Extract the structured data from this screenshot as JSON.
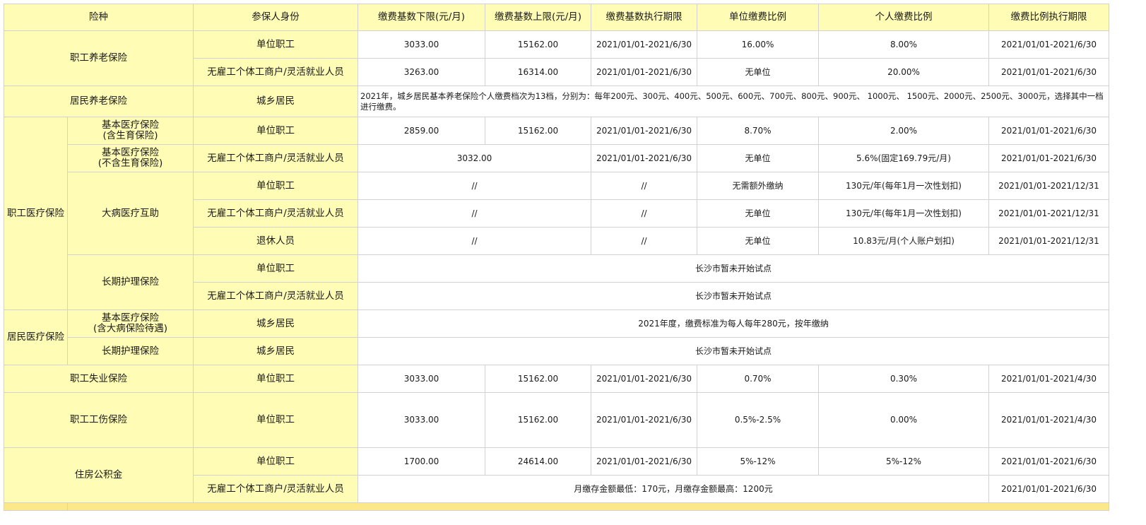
{
  "headers": [
    "险种",
    "参保人身份",
    "缴费基数下限(元/月)",
    "缴费基数上限(元/月)",
    "缴费基数执行期限",
    "单位缴费比例",
    "个人缴费比例",
    "缴费比例执行期限"
  ],
  "pension": {
    "name": "职工养老保险",
    "rows": [
      {
        "identity": "单位职工",
        "lower": "3033.00",
        "upper": "15162.00",
        "base_period": "2021/01/01-2021/6/30",
        "unit_ratio": "16.00%",
        "personal_ratio": "8.00%",
        "ratio_period": "2021/01/01-2021/6/30"
      },
      {
        "identity": "无雇工个体工商户/灵活就业人员",
        "lower": "3263.00",
        "upper": "16314.00",
        "base_period": "2021/01/01-2021/6/30",
        "unit_ratio": "无单位",
        "personal_ratio": "20.00%",
        "ratio_period": "2021/01/01-2021/6/30"
      }
    ]
  },
  "resident_pension": {
    "name": "居民养老保险",
    "identity": "城乡居民",
    "note": "2021年，城乡居民基本养老保险个人缴费档次为13档，分别为：每年200元、300元、400元、500元、600元、700元、800元、900元、 1000元、 1500元、2000元、2500元、3000元，选择其中一档进行缴费。"
  },
  "medical": {
    "name": "职工医疗保险",
    "basic_with_maternity": {
      "sub_line1": "基本医疗保险",
      "sub_line2": "(含生育保险)",
      "identity": "单位职工",
      "lower": "2859.00",
      "upper": "15162.00",
      "base_period": "2021/01/01-2021/6/30",
      "unit_ratio": "8.70%",
      "personal_ratio": "2.00%",
      "ratio_period": "2021/01/01-2021/6/30"
    },
    "basic_without_maternity": {
      "sub_line1": "基本医疗保险",
      "sub_line2": "(不含生育保险)",
      "identity": "无雇工个体工商户/灵活就业人员",
      "base": "3032.00",
      "base_period": "2021/01/01-2021/6/30",
      "unit_ratio": "无单位",
      "personal_ratio": "5.6%(固定169.79元/月)",
      "ratio_period": "2021/01/01-2021/6/30"
    },
    "serious_illness": {
      "sub": "大病医疗互助",
      "rows": [
        {
          "identity": "单位职工",
          "base": "//",
          "base_period": "//",
          "unit_ratio": "无需额外缴纳",
          "personal_ratio": "130元/年(每年1月一次性划扣)",
          "ratio_period": "2021/01/01-2021/12/31"
        },
        {
          "identity": "无雇工个体工商户/灵活就业人员",
          "base": "//",
          "base_period": "//",
          "unit_ratio": "无单位",
          "personal_ratio": "130元/年(每年1月一次性划扣)",
          "ratio_period": "2021/01/01-2021/12/31"
        },
        {
          "identity": "退休人员",
          "base": "//",
          "base_period": "//",
          "unit_ratio": "无单位",
          "personal_ratio": "10.83元/月(个人账户划扣)",
          "ratio_period": "2021/01/01-2021/12/31"
        }
      ]
    },
    "long_term_care": {
      "sub": "长期护理保险",
      "rows": [
        {
          "identity": "单位职工",
          "note": "长沙市暂未开始试点"
        },
        {
          "identity": "无雇工个体工商户/灵活就业人员",
          "note": "长沙市暂未开始试点"
        }
      ]
    }
  },
  "resident_medical": {
    "name": "居民医疗保险",
    "basic": {
      "sub_line1": "基本医疗保险",
      "sub_line2": "(含大病保险待遇)",
      "identity": "城乡居民",
      "note": "2021年度，缴费标准为每人每年280元，按年缴纳"
    },
    "care": {
      "sub": "长期护理保险",
      "identity": "城乡居民",
      "note": "长沙市暂未开始试点"
    }
  },
  "unemployment": {
    "name": "职工失业保险",
    "identity": "单位职工",
    "lower": "3033.00",
    "upper": "15162.00",
    "base_period": "2021/01/01-2021/6/30",
    "unit_ratio": "0.70%",
    "personal_ratio": "0.30%",
    "ratio_period": "2021/01/01-2021/4/30"
  },
  "injury": {
    "name": "职工工伤保险",
    "identity": "单位职工",
    "lower": "3033.00",
    "upper": "15162.00",
    "base_period": "2021/01/01-2021/6/30",
    "unit_ratio": "0.5%-2.5%",
    "personal_ratio": "0.00%",
    "ratio_period": "2021/01/01-2021/4/30"
  },
  "housing_fund": {
    "name": "住房公积金",
    "unit": {
      "identity": "单位职工",
      "lower": "1700.00",
      "upper": "24614.00",
      "base_period": "2021/01/01-2021/6/30",
      "unit_ratio": "5%-12%",
      "personal_ratio": "5%-12%",
      "ratio_period": "2021/01/01-2021/6/30"
    },
    "flexible": {
      "identity": "无雇工个体工商户/灵活就业人员",
      "note": "月缴存金额最低：170元，月缴存金额最高：1200元",
      "ratio_period": "2021/01/01-2021/6/30"
    }
  },
  "colors": {
    "header_bg": "#fffcb5",
    "category_bg": "#fffcb5",
    "footer_bg": "#fde889",
    "grid": "#d2d2d2"
  }
}
